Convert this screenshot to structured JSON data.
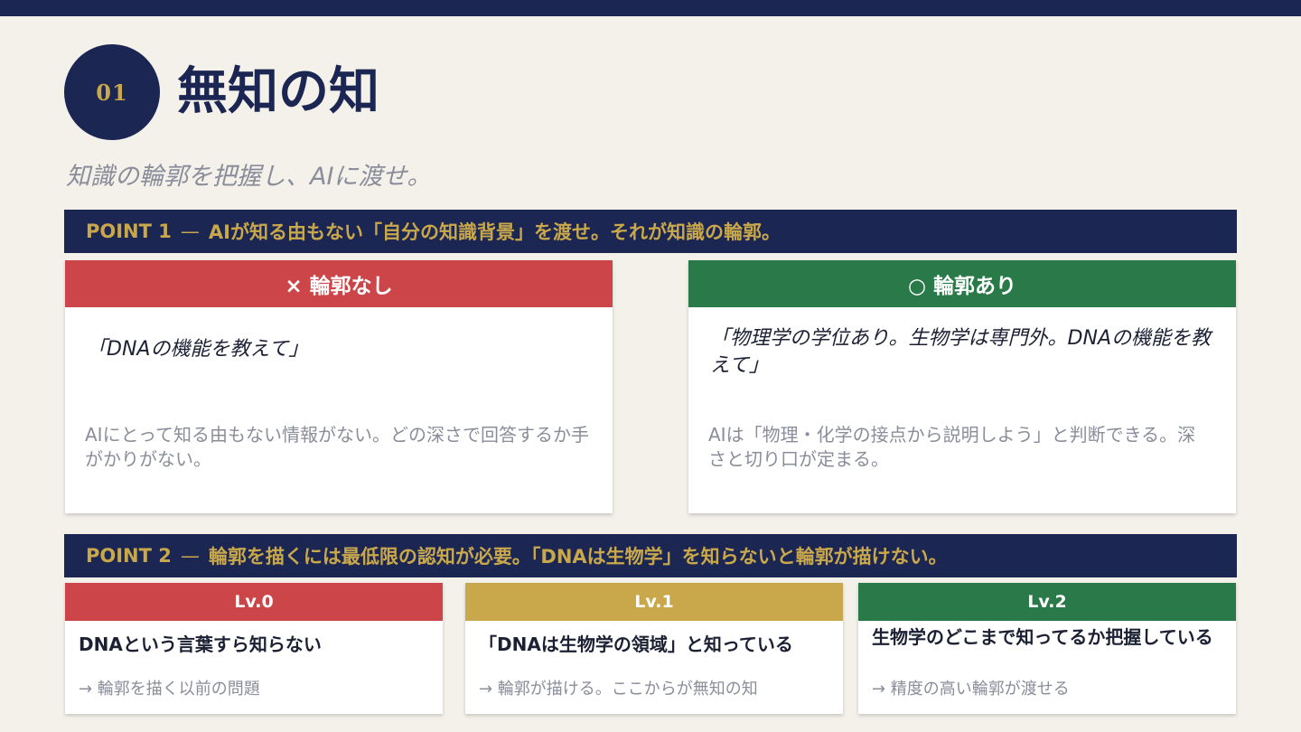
{
  "header": {
    "number": "01",
    "title": "無知の知",
    "subtitle": "知識の輪郭を把握し、AIに渡せ。"
  },
  "point1": {
    "label": "POINT 1",
    "dash": "—",
    "text": "AIが知る由もない「自分の知識背景」を渡せ。それが知識の輪郭。"
  },
  "comparison": {
    "left": {
      "heading": "× 輪郭なし",
      "quote": "「DNAの機能を教えて」",
      "description": "AIにとって知る由もない情報がない。どの深さで回答するか手がかりがない。"
    },
    "right": {
      "heading": "○ 輪郭あり",
      "quote": "「物理学の学位あり。生物学は専門外。DNAの機能を教えて」",
      "description": "AIは「物理・化学の接点から説明しよう」と判断できる。深さと切り口が定まる。"
    }
  },
  "point2": {
    "label": "POINT 2",
    "dash": "—",
    "text": "輪郭を描くには最低限の認知が必要。「DNAは生物学」を知らないと輪郭が描けない。"
  },
  "levels": [
    {
      "heading": "Lv.0",
      "main": "DNAという言葉すら知らない",
      "note": "→ 輪郭を描く以前の問題"
    },
    {
      "heading": "Lv.1",
      "main": "「DNAは生物学の領域」と知っている",
      "note": "→ 輪郭が描ける。ここからが無知の知"
    },
    {
      "heading": "Lv.2",
      "main": "生物学のどこまで知ってるか把握している",
      "note": "→ 精度の高い輪郭が渡せる"
    }
  ],
  "colors": {
    "navy": "#1c2653",
    "gold": "#c9a84b",
    "red": "#cc4549",
    "green": "#2a7a49",
    "background": "#f4f1ea"
  }
}
